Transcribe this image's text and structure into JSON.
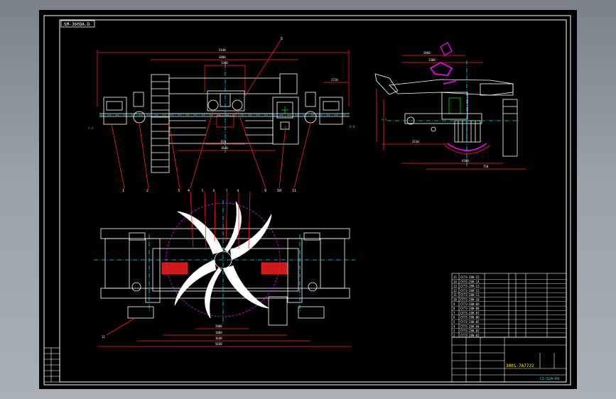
{
  "drawing": {
    "title_tag": "SM-360DA.D",
    "title_block_name": "3001-7A7722",
    "title_block_code": "C1-52A-R9",
    "callouts": [
      "1",
      "2",
      "3",
      "4",
      "5",
      "6",
      "7",
      "8",
      "9",
      "10",
      "11"
    ],
    "dims_front": [
      "5440",
      "3000",
      "1380",
      "1720",
      "920",
      "1640",
      "840"
    ],
    "dims_plan": [
      "2800",
      "1880",
      "3640",
      "5640"
    ],
    "dims_side": [
      "2060",
      "1300",
      "2410",
      "4100",
      "750",
      "2500",
      "1600",
      "1300",
      "3020",
      "1250"
    ],
    "parts_list": [
      {
        "no": "15",
        "code": "CY73-28H-15"
      },
      {
        "no": "14",
        "code": "CY73-28H-14"
      },
      {
        "no": "13",
        "code": "CY73-28H-13"
      },
      {
        "no": "12",
        "code": "CY73-28H-12"
      },
      {
        "no": "11",
        "code": "CY73-28H-11"
      },
      {
        "no": "10",
        "code": "CY73-28H-10"
      },
      {
        "no": "9",
        "code": "CY73-28H-09"
      },
      {
        "no": "8",
        "code": "CY73-28H-08"
      },
      {
        "no": "7",
        "code": "CY73-28H-07"
      },
      {
        "no": "6",
        "code": "CY73-28H-06"
      },
      {
        "no": "5",
        "code": "CY73-28H-05"
      },
      {
        "no": "4",
        "code": "CY73-28H-04"
      },
      {
        "no": "3",
        "code": "CY73-28H-03"
      },
      {
        "no": "2",
        "code": "CY73-28H-02"
      }
    ]
  },
  "colors": {
    "border": "#ffffff",
    "outline": "#ffffff",
    "dimension": "#ff2020",
    "centerline": "#00e5e5",
    "hatch": "#00e000",
    "accent": "#ff00ff"
  }
}
